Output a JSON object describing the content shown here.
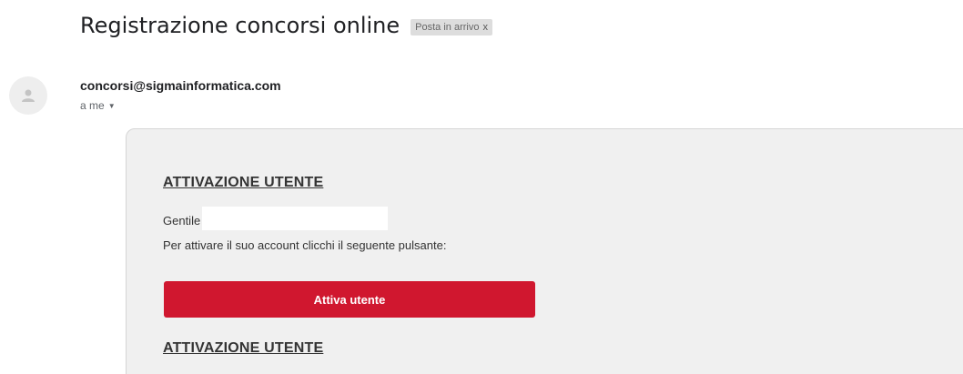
{
  "email": {
    "subject": "Registrazione concorsi online",
    "label_chip": {
      "text": "Posta in arrivo",
      "close": "x"
    },
    "sender": "concorsi@sigmainformatica.com",
    "recipient": "a me",
    "recipient_dropdown_icon": "caret-down-icon",
    "avatar_icon": "person-icon"
  },
  "body": {
    "heading_top": "ATTIVAZIONE UTENTE",
    "greeting": "Gentile",
    "instruction": "Per attivare il suo account clicchi il seguente pulsante:",
    "button_label": "Attiva utente",
    "heading_bottom": "ATTIVAZIONE UTENTE"
  },
  "colors": {
    "button": "#d0172f",
    "card_background": "#f0f0f0",
    "chip_background": "#dddddd"
  }
}
